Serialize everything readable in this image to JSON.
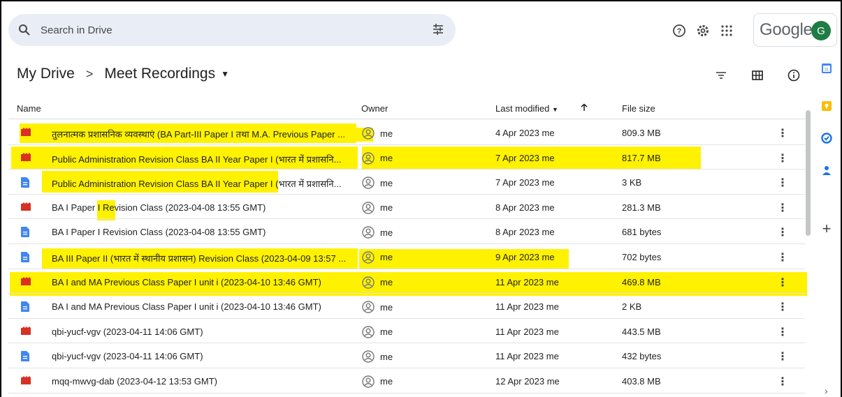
{
  "search": {
    "placeholder": "Search in Drive"
  },
  "account": {
    "brand": "Google",
    "avatar_letter": "G"
  },
  "breadcrumb": {
    "root": "My Drive",
    "separator": ">",
    "current": "Meet Recordings"
  },
  "columns": {
    "name": "Name",
    "owner": "Owner",
    "modified": "Last modified",
    "size": "File size"
  },
  "colors": {
    "highlight": "#fff200",
    "video": "#d93025",
    "doc": "#4285f4"
  },
  "files": [
    {
      "type": "video",
      "name": "तुलनात्मक प्रशासनिक व्यवस्थाएं (BA Part-III Paper I तथा M.A. Previous Paper ...",
      "owner": "me",
      "modified": "4 Apr 2023 me",
      "size": "809.3 MB"
    },
    {
      "type": "video",
      "name": "Public Administration Revision Class BA II Year Paper I (भारत में प्रशासनि...",
      "owner": "me",
      "modified": "7 Apr 2023 me",
      "size": "817.7 MB"
    },
    {
      "type": "doc",
      "name": "Public Administration Revision Class BA II Year Paper I (भारत में प्रशासनि...",
      "owner": "me",
      "modified": "7 Apr 2023 me",
      "size": "3 KB"
    },
    {
      "type": "video",
      "name": "BA I Paper I Revision Class (2023-04-08 13:55 GMT)",
      "owner": "me",
      "modified": "8 Apr 2023 me",
      "size": "281.3 MB"
    },
    {
      "type": "doc",
      "name": "BA I Paper I Revision Class (2023-04-08 13:55 GMT)",
      "owner": "me",
      "modified": "8 Apr 2023 me",
      "size": "681 bytes"
    },
    {
      "type": "doc",
      "name": "BA III Paper II (भारत में स्थानीय प्रशासन) Revision Class  (2023-04-09 13:57 ...",
      "owner": "me",
      "modified": "9 Apr 2023 me",
      "size": "702 bytes"
    },
    {
      "type": "video",
      "name": "BA I and MA Previous Class Paper I unit i (2023-04-10 13:46 GMT)",
      "owner": "me",
      "modified": "11 Apr 2023 me",
      "size": "469.8 MB"
    },
    {
      "type": "doc",
      "name": "BA I and MA Previous Class Paper I unit i (2023-04-10 13:46 GMT)",
      "owner": "me",
      "modified": "11 Apr 2023 me",
      "size": "2 KB"
    },
    {
      "type": "video",
      "name": "qbi-yucf-vgv (2023-04-11 14:06 GMT)",
      "owner": "me",
      "modified": "11 Apr 2023 me",
      "size": "443.5 MB"
    },
    {
      "type": "doc",
      "name": "qbi-yucf-vgv (2023-04-11 14:06 GMT)",
      "owner": "me",
      "modified": "11 Apr 2023 me",
      "size": "432 bytes"
    },
    {
      "type": "video",
      "name": "mqq-mwvg-dab (2023-04-12 13:53 GMT)",
      "owner": "me",
      "modified": "12 Apr 2023 me",
      "size": "403.8 MB"
    }
  ]
}
